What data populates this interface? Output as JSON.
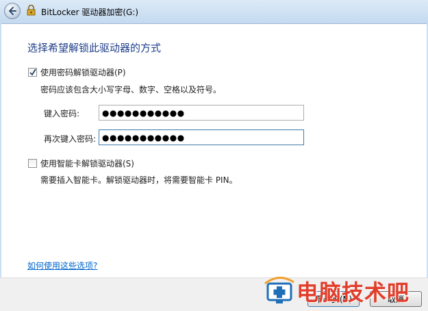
{
  "window": {
    "title": "BitLocker 驱动器加密(G:)"
  },
  "page": {
    "heading": "选择希望解锁此驱动器的方式"
  },
  "password_option": {
    "label": "使用密码解锁驱动器(P)",
    "checked": true,
    "description": "密码应该包含大小写字母、数字、空格以及符号。",
    "enter_label": "键入密码:",
    "enter_value": "●●●●●●●●●●●",
    "reenter_label": "再次键入密码:",
    "reenter_value": "●●●●●●●●●●●"
  },
  "smartcard_option": {
    "label": "使用智能卡解锁驱动器(S)",
    "checked": false,
    "description": "需要插入智能卡。解锁驱动器时，将需要智能卡 PIN。"
  },
  "help": {
    "link": "如何使用这些选项?"
  },
  "footer": {
    "next_label": "下一步(N)",
    "cancel_label": "取消"
  },
  "watermark": {
    "text": "电脑技术吧",
    "color": "#e23d2a"
  },
  "icons": {
    "back": "back-arrow-icon",
    "title": "bitlocker-key-icon",
    "logo": "monitor-plus-logo"
  }
}
